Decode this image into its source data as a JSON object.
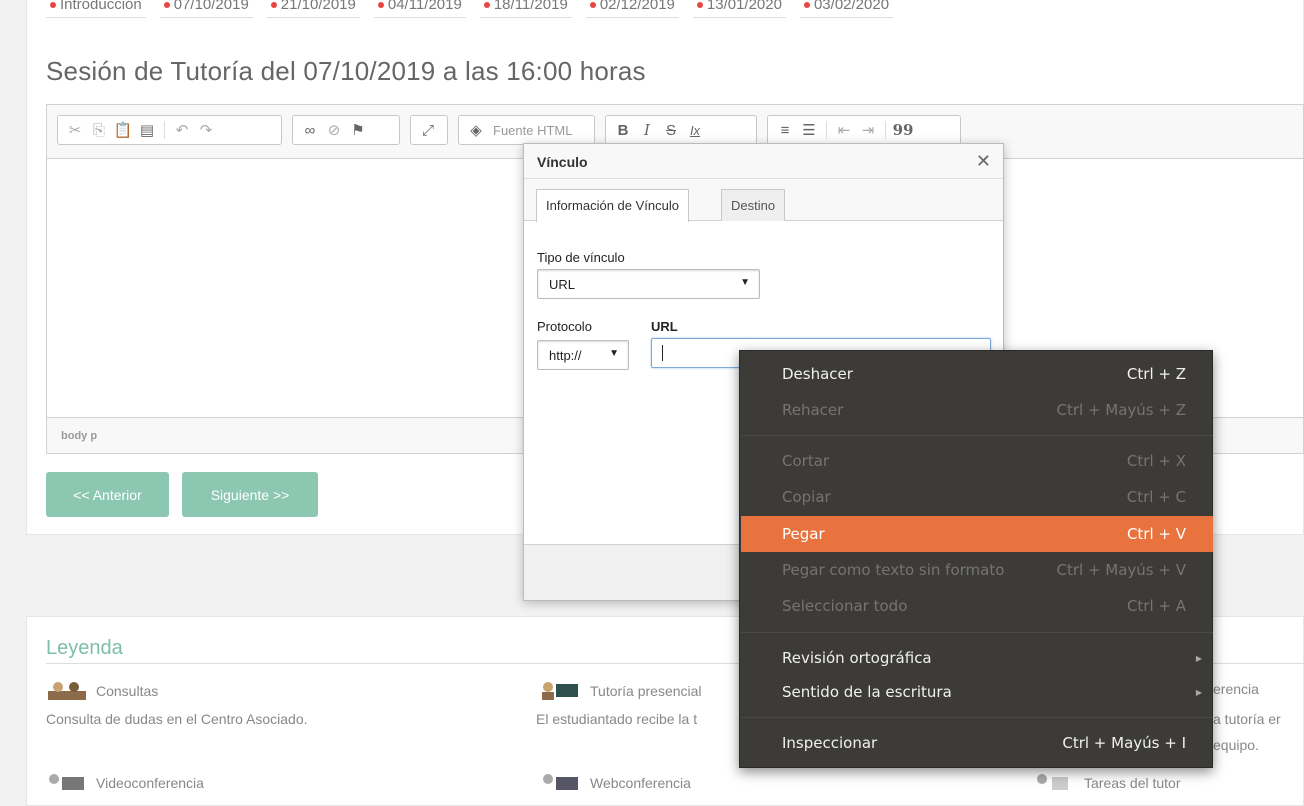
{
  "date_tabs": [
    "Introducción",
    "07/10/2019",
    "21/10/2019",
    "04/11/2019",
    "18/11/2019",
    "02/12/2019",
    "13/01/2020",
    "03/02/2020"
  ],
  "session_title": "Sesión de Tutoría del 07/10/2019 a las 16:00 horas",
  "toolbar": {
    "source_label": "Fuente HTML",
    "bold": "B",
    "italic": "I",
    "strike": "S",
    "clear": "Ix",
    "quote": "99"
  },
  "editor_footer": "body  p",
  "nav": {
    "prev": "<< Anterior",
    "next": "Siguiente >>"
  },
  "dialog": {
    "title": "Vínculo",
    "close": "✕",
    "tabs": [
      "Información de Vínculo",
      "Destino"
    ],
    "link_type_label": "Tipo de vínculo",
    "link_type_value": "URL",
    "protocol_label": "Protocolo",
    "protocol_value": "http://",
    "url_label": "URL",
    "url_value": ""
  },
  "context_menu": {
    "items": [
      {
        "label": "Deshacer",
        "shortcut": "Ctrl + Z",
        "state": "enabled"
      },
      {
        "label": "Rehacer",
        "shortcut": "Ctrl + Mayús + Z",
        "state": "disabled"
      },
      {
        "label": "Cortar",
        "shortcut": "Ctrl + X",
        "state": "disabled"
      },
      {
        "label": "Copiar",
        "shortcut": "Ctrl + C",
        "state": "disabled"
      },
      {
        "label": "Pegar",
        "shortcut": "Ctrl + V",
        "state": "highlighted"
      },
      {
        "label": "Pegar como texto sin formato",
        "shortcut": "Ctrl + Mayús + V",
        "state": "disabled"
      },
      {
        "label": "Seleccionar todo",
        "shortcut": "Ctrl + A",
        "state": "disabled"
      },
      {
        "label": "Revisión ortográfica",
        "shortcut": "",
        "state": "enabled"
      },
      {
        "label": "Sentido de la escritura",
        "shortcut": "",
        "state": "enabled"
      },
      {
        "label": "Inspeccionar",
        "shortcut": "Ctrl + Mayús + I",
        "state": "enabled"
      }
    ],
    "highlight_color": "#e9733f"
  },
  "legend": {
    "title": "Leyenda",
    "items": [
      {
        "label": "Consultas",
        "desc": "Consulta de dudas en el Centro Asociado.",
        "icon": "consultas-icon"
      },
      {
        "label": "Tutoría presencial",
        "desc": "El estudiantado recibe la t",
        "icon": "tutoria-presencial-icon"
      },
      {
        "label": "erencia",
        "desc": "a tutoría er",
        "icon": ""
      },
      {
        "label": "Videoconferencia",
        "icon": "videoconferencia-icon"
      },
      {
        "label": "Webconferencia",
        "icon": "webconferencia-icon"
      },
      {
        "label": "Tareas del tutor",
        "icon": "tareas-tutor-icon"
      }
    ],
    "extra_fragment": "equipo."
  },
  "colors": {
    "accent": "#8cc7b2",
    "legend_title": "#7bbfa7",
    "dot": "#e84545"
  }
}
